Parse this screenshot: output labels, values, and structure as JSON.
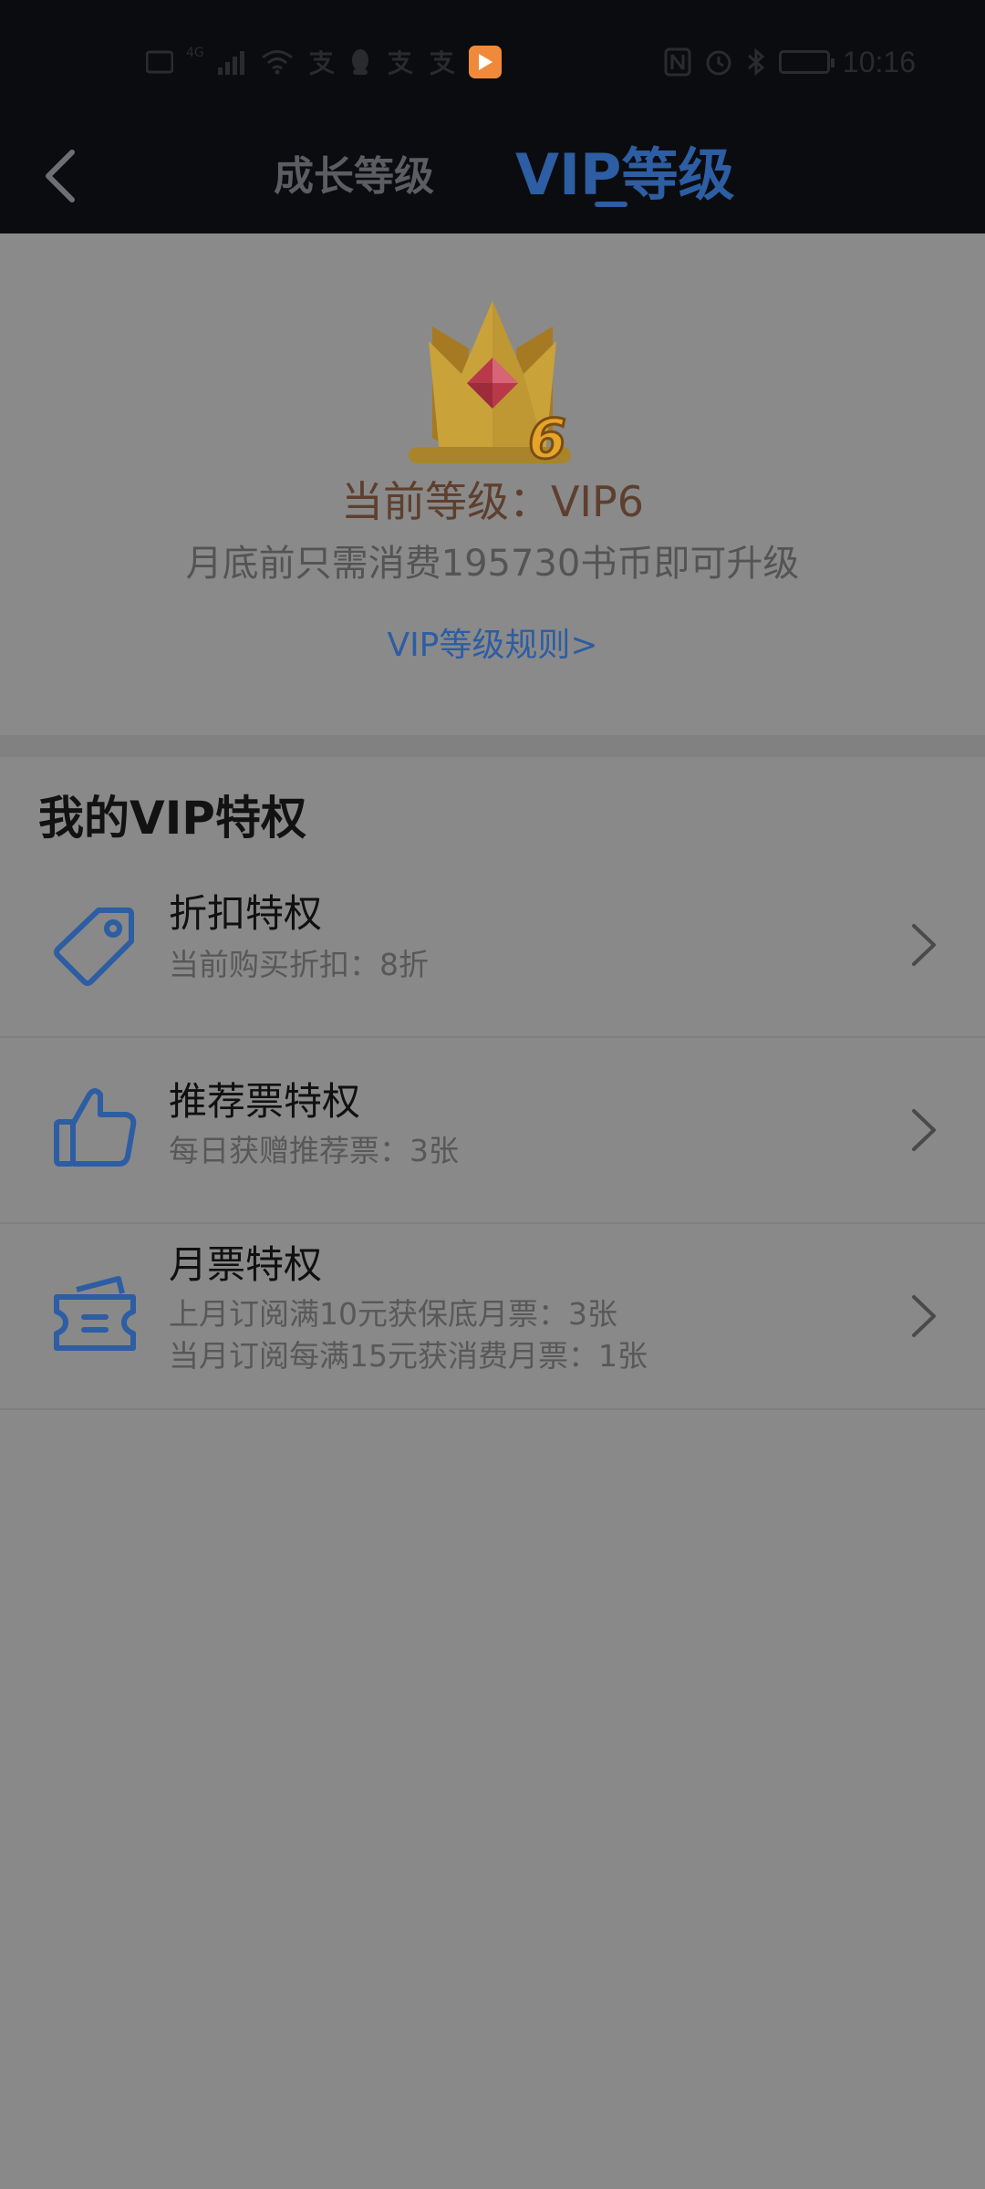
{
  "status_bar": {
    "time": "10:16",
    "network_label": "4G",
    "left_icons": [
      "hd-icon",
      "signal-icon",
      "wifi-icon",
      "alipay-icon",
      "qq-icon",
      "alipay-icon",
      "alipay-icon",
      "app-icon"
    ],
    "right_icons": [
      "nfc-icon",
      "alarm-icon",
      "bluetooth-icon",
      "battery-icon"
    ]
  },
  "nav": {
    "back_icon": "chevron-left-icon",
    "tabs": [
      {
        "label": "成长等级",
        "active": false
      },
      {
        "label": "VIP等级",
        "active": true
      }
    ]
  },
  "level": {
    "badge_number": "6",
    "current_level": "当前等级：VIP6",
    "upgrade_hint": "月底前只需消费195730书币即可升级",
    "rules_link": "VIP等级规则>"
  },
  "privileges": {
    "section_title": "我的VIP特权",
    "items": [
      {
        "icon": "tag-icon",
        "title": "折扣特权",
        "lines": [
          "当前购买折扣：8折"
        ]
      },
      {
        "icon": "thumbs-up-icon",
        "title": "推荐票特权",
        "lines": [
          "每日获赠推荐票：3张"
        ]
      },
      {
        "icon": "ticket-icon",
        "title": "月票特权",
        "lines": [
          "上月订阅满10元获保底月票：3张",
          "当月订阅每满15元获消费月票：1张"
        ]
      }
    ]
  },
  "colors": {
    "accent": "#2d5da3",
    "level_text": "#5e3f2d",
    "crown_gold": "#c9a23a",
    "background_dim": "#898989",
    "bar_dark": "#0b0c0f"
  }
}
